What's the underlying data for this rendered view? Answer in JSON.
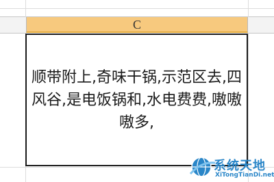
{
  "spreadsheet": {
    "column_header": "C",
    "cell_text": "顺带附上,奇味干锅,示范区去,四风谷,是电饭锅和,水电费费,嗷嗷嗷多,"
  },
  "watermark": {
    "name": "系统天地",
    "url": "XiTongTianDi.net"
  },
  "colors": {
    "header_selected": "#f7c97e",
    "cell_border": "#1a1a1a",
    "watermark": "#2a86c8"
  }
}
